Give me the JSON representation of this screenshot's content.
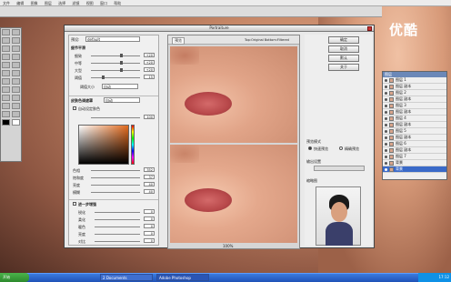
{
  "watermark": "优酷",
  "dialog": {
    "title": "Portraiture",
    "preset_label": "预设:",
    "preset_value": "default",
    "preview_tab": "预览",
    "preview_option": "Top:Original Bottom:Filtered",
    "zoom": "100%",
    "buttons": [
      "确定",
      "取消",
      "默认",
      "关于"
    ],
    "detail_section": "细节平滑",
    "detail_sliders": [
      {
        "label": "细致",
        "value": "+20"
      },
      {
        "label": "中等",
        "value": "+20"
      },
      {
        "label": "大型",
        "value": "+20"
      },
      {
        "label": "阈值",
        "value": "15"
      }
    ],
    "size_label": "阈值大小",
    "size_value": "自动",
    "mask_section": "皮肤色调遮罩",
    "mask_mode": "自动",
    "mask_checkbox": "自动设定肤色",
    "mask_tolerance": "100",
    "hsl_sliders": [
      {
        "label": "色相",
        "value": "352"
      },
      {
        "label": "饱和度",
        "value": "37"
      },
      {
        "label": "亮度",
        "value": "40"
      },
      {
        "label": "模糊",
        "value": "40"
      }
    ],
    "enhance_section": "进一步增强",
    "enhance_sliders": [
      {
        "label": "锐化",
        "value": "0"
      },
      {
        "label": "柔化",
        "value": "0"
      },
      {
        "label": "暖色",
        "value": "0"
      },
      {
        "label": "亮度",
        "value": "0"
      },
      {
        "label": "对比",
        "value": "0"
      }
    ],
    "preview_mode_label": "预览模式",
    "preview_mode_options": [
      "快速预览",
      "精确预览"
    ],
    "output_label": "输出设置",
    "thumbnail_label": "缩略图"
  },
  "layers": {
    "title": "图层",
    "items": [
      "图层 1",
      "图层 副本",
      "图层 2",
      "图层 副本",
      "图层 3",
      "图层 副本",
      "图层 4",
      "图层 副本",
      "图层 5",
      "图层 副本",
      "图层 6",
      "图层 副本",
      "图层 7",
      "背景"
    ]
  },
  "taskbar": {
    "start": "开始",
    "tasks": [
      "2 Documents",
      "Adobe Photoshop"
    ],
    "clock": "17:12"
  },
  "menubar": [
    "文件",
    "编辑",
    "图像",
    "图层",
    "选择",
    "滤镜",
    "视图",
    "窗口",
    "帮助"
  ]
}
